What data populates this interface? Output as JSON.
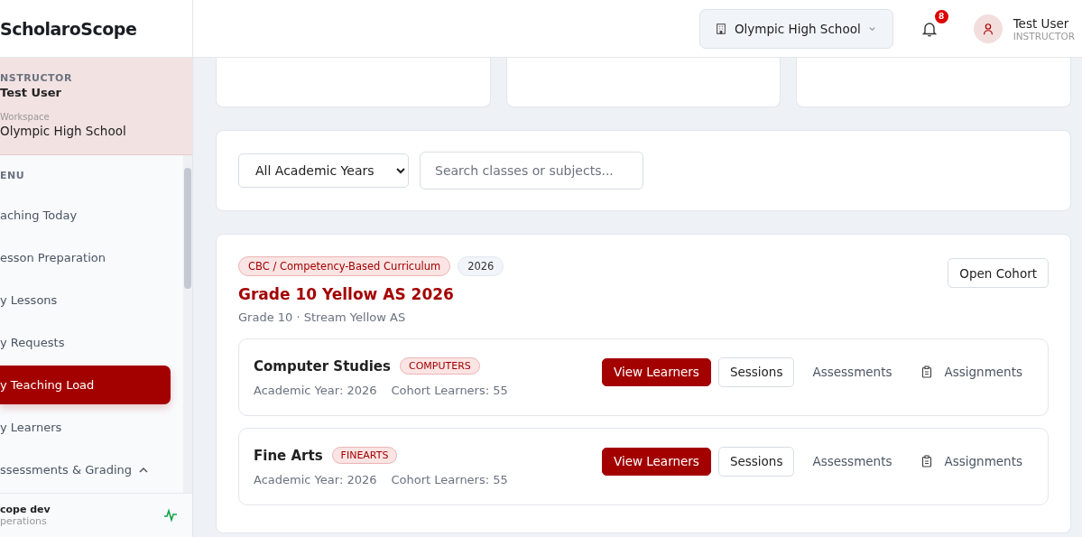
{
  "brand": "ScholaroScope",
  "profile": {
    "role": "NSTRUCTOR",
    "name": "Test User",
    "workspace_label": "Workspace",
    "workspace": "Olympic High School"
  },
  "menu": {
    "heading": "ENU",
    "items": [
      {
        "label": "aching Today",
        "selected": false
      },
      {
        "label": "esson Preparation",
        "selected": false
      },
      {
        "label": "y Lessons",
        "selected": false
      },
      {
        "label": "y Requests",
        "selected": false
      },
      {
        "label": "y Teaching Load",
        "selected": true
      },
      {
        "label": "y Learners",
        "selected": false
      },
      {
        "label": "ssessments & Grading",
        "selected": false,
        "expanded": true
      }
    ]
  },
  "sidebar_footer": {
    "title": "cope dev",
    "subtitle": "perations"
  },
  "header": {
    "school": "Olympic High School",
    "notifications": "8",
    "user_name": "Test User",
    "user_role": "INSTRUCTOR"
  },
  "filters": {
    "year": "All Academic Years",
    "search_placeholder": "Search classes or subjects..."
  },
  "cohort": {
    "curriculum": "CBC / Competency-Based Curriculum",
    "year": "2026",
    "title": "Grade 10 Yellow AS 2026",
    "subtitle": "Grade 10 · Stream Yellow AS",
    "open_button": "Open Cohort",
    "subjects": [
      {
        "name": "Computer Studies",
        "code": "COMPUTERS",
        "academic_year": "Academic Year: 2026",
        "learners": "Cohort Learners: 55",
        "actions": [
          "View Learners",
          "Sessions",
          "Assessments",
          "Assignments"
        ]
      },
      {
        "name": "Fine Arts",
        "code": "FINEARTS",
        "academic_year": "Academic Year: 2026",
        "learners": "Cohort Learners: 55",
        "actions": [
          "View Learners",
          "Sessions",
          "Assessments",
          "Assignments"
        ]
      }
    ]
  }
}
